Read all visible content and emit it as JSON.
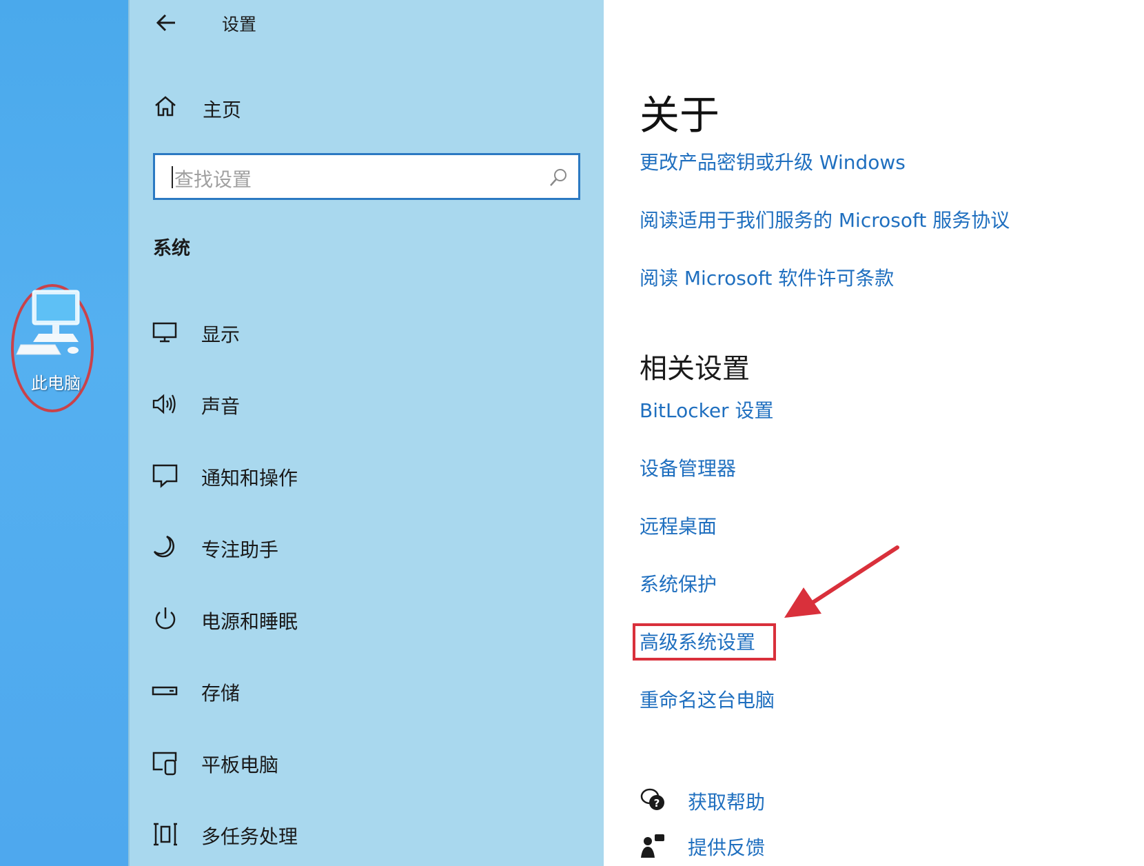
{
  "desktop": {
    "icon_label": "此电脑",
    "highlight_color": "#c9424a"
  },
  "nav": {
    "back_icon": "back-arrow-icon",
    "title": "设置",
    "home_label": "主页",
    "search_placeholder": "查找设置",
    "section_title": "系统",
    "items": [
      {
        "label": "显示",
        "icon": "monitor-icon"
      },
      {
        "label": "声音",
        "icon": "speaker-icon"
      },
      {
        "label": "通知和操作",
        "icon": "notification-icon"
      },
      {
        "label": "专注助手",
        "icon": "moon-icon"
      },
      {
        "label": "电源和睡眠",
        "icon": "power-icon"
      },
      {
        "label": "存储",
        "icon": "storage-icon"
      },
      {
        "label": "平板电脑",
        "icon": "tablet-icon"
      },
      {
        "label": "多任务处理",
        "icon": "multitask-icon"
      }
    ],
    "background": "#a9d8ee"
  },
  "content": {
    "title": "关于",
    "links": [
      "更改产品密钥或升级 Windows",
      "阅读适用于我们服务的 Microsoft 服务协议",
      "阅读 Microsoft 软件许可条款"
    ],
    "related_title": "相关设置",
    "related_links": [
      "BitLocker 设置",
      "设备管理器",
      "远程桌面",
      "系统保护",
      "高级系统设置",
      "重命名这台电脑"
    ],
    "help": {
      "get_help": "获取帮助",
      "feedback": "提供反馈"
    },
    "link_color": "#1f6fbf",
    "annotation_color": "#d9303b"
  }
}
